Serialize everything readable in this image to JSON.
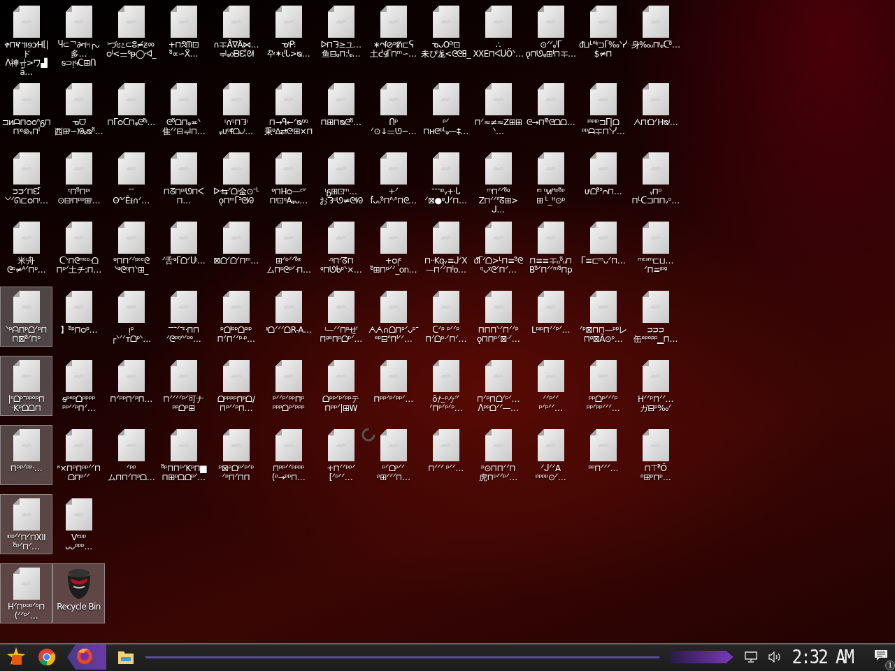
{
  "desktop": {
    "rows": [
      [
        {
          "kind": "file",
          "label": "ቀ⊓ኛ៕ɘɔ⁄H[|ド\nᐱ神ᆉ>ワ▟ǻ…",
          "selected": false
        },
        {
          "kind": "file",
          "label": "Ⴗ⊂ᄀ∂ન৸┌ᴗ多…\nᵴ⊃ᴉ५ᑕ⊞ᑎ",
          "selected": false
        },
        {
          "kind": "file",
          "label": "ᵎづ೮೭⊂ⵓ≠ᵶᇮ\nᴑᑊ<ᆖ⁶ᵽ◯ᐗ_",
          "selected": false
        },
        {
          "kind": "file",
          "label": "+⊓ᘝᗰ⊡\nᵒ̃∝∽Ẍ…",
          "selected": false
        },
        {
          "kind": "file",
          "label": "∩ᆍÅ∇Ä⋈…\nᆗᵩ᧐ᗸᘿᘛ",
          "selected": false
        },
        {
          "kind": "file",
          "label": "ᓀᵎᑭ⫶\n卆✶ɩᑊᒐ>ᴓ…",
          "selected": false
        },
        {
          "kind": "file",
          "label": "ᐅ⊓ᘊ≥ユ…\n鱼⊟ᵩ⊓:ᑊᵩ…",
          "selected": false
        },
        {
          "kind": "file",
          "label": "∗ᴖᵮ⊘ᵖᵺ⊏ᕋ\n土ᕍ፶ᒥ⊓ᵐ∽…",
          "selected": false
        },
        {
          "kind": "file",
          "label": "ᓀᴗO⁰ᵎ⊡\n未ぴ尨<ᘓᘓ𐌇_",
          "selected": false
        },
        {
          "kind": "file",
          "label": "∴\nXXE⊓ᐸᑌÖᐠ…",
          "selected": false
        },
        {
          "kind": "file",
          "label": "⊙ᐟᐟᵩᑊᒥ\nǫ⊓ᘎᵩ⊞ᑊ⊓ᆍ…",
          "selected": false
        },
        {
          "kind": "file",
          "label": "ᵭ⊔ᒻᐢᑊᵎ⊐ᒥ‰ᐠᓯ\n$≠⊓",
          "selected": false
        },
        {
          "kind": "file",
          "label": "身‰ᵤ⊓ᵎᵩᑕᵒ̃…",
          "selected": false
        }
      ],
      [
        {
          "kind": "file",
          "label": "⊐ᴎᗩ⊓ᴑᴑᐢᵷ⊓\n⊓ᵡᵎ⊚ᵧ⊓ᑊ",
          "selected": false
        },
        {
          "kind": "file",
          "label": "ᓀᗜ\n西⊞ᵎ∽ᘠᵩᴓᵒ̃…",
          "selected": false
        },
        {
          "kind": "file",
          "label": "⊓ᒥᴑᑕ⊓ᵩᘓᵒ̃ᵎ…",
          "selected": false
        },
        {
          "kind": "file",
          "label": "ᘓᵒ̃ᗝ⊓ᵩ≖ᐠ\n隹ᐟᐟ⊟ᆗ⊓…",
          "selected": false
        },
        {
          "kind": "file",
          "label": "ᵎ∩ᵑ⊓ᘊᵎ\nᵩᴜᵑᵎᵮᗝᴗᵎ…",
          "selected": false
        },
        {
          "kind": "file",
          "label": "⊓→ᑫ←ᐟᴓᵑᵑ\n秉ᵍ∆⇄ᘓᵎ⊞×⊓",
          "selected": false
        },
        {
          "kind": "file",
          "label": "⊓⊞⊓ᴓᘓᵒ̃…",
          "selected": false
        },
        {
          "kind": "file",
          "label": "ᑎᵖ\nᐟ⊙↓ᆖᘎ∽…",
          "selected": false
        },
        {
          "kind": "file",
          "label": "ᵖᐟ\n⊓ʜᘓᵇᒻᵩ—‡…",
          "selected": false
        },
        {
          "kind": "file",
          "label": "⊓ᐟ≈≠≈Z⊞⊞ᐠ…",
          "selected": false
        },
        {
          "kind": "file",
          "label": "ᘓ→⊓ᑊᵒ̃ᘓᗝᗝ…",
          "selected": false
        },
        {
          "kind": "file",
          "label": "ᵎᵒᵖᵎᵖ⊐ᒥ|ᗝ\nᵖᵖᗩᆍ⊓ᐠᓯ…",
          "selected": false
        },
        {
          "kind": "file",
          "label": "ᗅ⊓ᵎᗝᐟHᴓᵎ…",
          "selected": false
        }
      ],
      [
        {
          "kind": "file",
          "label": "ᴝᴝᐟ⊓ᘿ\nᐠᐟᐟᘏ⊏ᴑ⊓ᵎ…",
          "selected": false
        },
        {
          "kind": "file",
          "label": "ᵋ⊓ᵒ̃⊓ᵖᵎ\n⊙⊟ᵎ⊓ᵖᵖ⊞ᵎ…",
          "selected": false
        },
        {
          "kind": "file",
          "label": "ᐨᐨ\nʘᐢᐟÊᵻ∩ᐟ…",
          "selected": false
        },
        {
          "kind": "file",
          "label": "⊓ᘔ⊓ᵖᵎᘎ⊓ᐸ⊓…",
          "selected": false
        },
        {
          "kind": "file",
          "label": "ᐅᐧ⇆ᐟᗝᵎ金⊙ᐨᒻ\nǫ⊓ᵐᒥᐣᘓᘗ",
          "selected": false
        },
        {
          "kind": "file",
          "label": "ᵠ⊓Hᴑ—ᵋᐡ\n⊓ᵎ⊡ᵑAᵩᴗ…",
          "selected": false
        },
        {
          "kind": "file",
          "label": "ᵎᵷ⊞⊡ᵐ…\nおᘊᵖᘎ≠ᘓᵎᘗ",
          "selected": false
        },
        {
          "kind": "file",
          "label": "+ᐟ\nf̂ᴗᵤᵒ̃⊓ᐢᐧᐢ⊓ᘓ…",
          "selected": false
        },
        {
          "kind": "file",
          "label": "ᐨᐨᐨᵎᵖᵧ+ᐧᒐ\nᐟ⊠●ᵠᒍᐟ⊓…",
          "selected": false
        },
        {
          "kind": "file",
          "label": "ᵐ⊓ᐟᐟᵒ̃ᵍ\nZ⊓ᐟᐟᐢᘔ⊞>ᒍ…",
          "selected": false
        },
        {
          "kind": "file",
          "label": "ᵎᵋᵎ ᵑᴎᴴᵖᵒ̃ᵖ\n⊞ ᒻ_ᴴ⊙ᵖ",
          "selected": false
        },
        {
          "kind": "file",
          "label": "ᴜᵎᗝᵉ̃ᐣᴒ⊓…",
          "selected": false
        },
        {
          "kind": "file",
          "label": "ᵧ⊓ᵖ\n⊓ᒻᑕ⊐⊓⊓ᵥᵒ…",
          "selected": false
        }
      ],
      [
        {
          "kind": "file",
          "label": "米ᵎ舟\nᘓᵖ≠ᴬᐟ⊓ᵖ…",
          "selected": false
        },
        {
          "kind": "file",
          "label": "ᑕᐠ⊓ᘓᵐᵋᵒᐧᗝ\n⊓ᵖᐟ土チ:⊓…",
          "selected": false
        },
        {
          "kind": "file",
          "label": "ᵠ⊓⊓ᐟᐟᵖᵋᵉᘓ\nᐠᵠᘓᵑ⊓ᐠ⊞_",
          "selected": false
        },
        {
          "kind": "file",
          "label": "ᐟ舌ᵠᒥᗝᐟᑌᵎ…",
          "selected": false
        },
        {
          "kind": "file",
          "label": "⊠ᗝᐟᗝᐟ⊓ᵐ…",
          "selected": false
        },
        {
          "kind": "file",
          "label": "⊞ᐟᵖᐟᐟᵒ̃ᵎᵋ\nム⊓ᵖᘓᵖᐟᐧ⊓…",
          "selected": false
        },
        {
          "kind": "file",
          "label": "ᐧᵑ⊓ᐟᘔ⊓\nᵍ⊓ᘎᑲᵖᐠ×…",
          "selected": false
        },
        {
          "kind": "file",
          "label": "+ᴑᴉᵋ\nᵉ̃⊞⊓ᵖᐟᐟ_on…",
          "selected": false
        },
        {
          "kind": "file",
          "label": "⊓ᐧᐧKqᵥ≡ᒍᐟX\n—⊓ᐟᐟ⊓ᑊo…",
          "selected": false
        },
        {
          "kind": "file",
          "label": "ᵭᒥᐟᗝ>ᒻ⊓≡ᵒ̃ᘓ\nᵑᴗᵡᘓᐟ⊓ᐟ…",
          "selected": false
        },
        {
          "kind": "file",
          "label": "⊓≡≡ᆍᵤᵒ̃ᵤ⊓\nBᵒ̃ᐟ⊓ᐟᐟᵐᵒ̃⊓p",
          "selected": false
        },
        {
          "kind": "file",
          "label": "ᒥ≡⊏ᵐᴗᐟ⊓…",
          "selected": false
        },
        {
          "kind": "file",
          "label": "ᵐᵋᵌᵐ⊏⊔…\nᐟ⊓≡ᵎᵖᵍ",
          "selected": false
        }
      ],
      [
        {
          "kind": "file",
          "label": "ᐠᵖᗩ⊓ᵖᗝᐟᵖ⊓\n⊓⊠ᵒ̃ᐟ⊓ᵖ",
          "selected": true
        },
        {
          "kind": "file",
          "label": "】ᵉ̃ᵖ⊓ᴑᵖ…",
          "selected": false
        },
        {
          "kind": "file",
          "label": "ᴉᵖ\n┌ᐠᐟᐟᴛᗝᵖᐠ…",
          "selected": false
        },
        {
          "kind": "file",
          "label": "ᐨᐨᐨᐟᐨᵋᐧ⊓⊓\nᐟᘓᵖᵑᐢᐟᵒᵒ…",
          "selected": false
        },
        {
          "kind": "file",
          "label": "ᵖᗝᑊᵖᵖᗝᵖᵎᵖ\n⊓ᐟ⊓ᐟᐟᵖᐧᵖ…",
          "selected": false
        },
        {
          "kind": "file",
          "label": "ᵡᗝᐟᐟᐟᗝR-A…",
          "selected": false
        },
        {
          "kind": "file",
          "label": "ᵎ—ᐟᐟ⊓ᵖぜ\n⊓ᵍᵉ⊓ᵖᗝᵖᐟ…",
          "selected": false
        },
        {
          "kind": "file",
          "label": "ᗅᗅ∩ᗝ⊓ᵖᐟᴗᵖᐨ\nᵉᵖ⊟ᐢ⊓ᑊᐟᐟ…",
          "selected": false
        },
        {
          "kind": "file",
          "label": "ᑕᐟᵖ ᵖᐟᐟᵖ\n⊓ᐟᗝᵖᐧᐟ⊓ᐟ…",
          "selected": false
        },
        {
          "kind": "file",
          "label": "⊓⊓⊓ᐠᐟ⊓ᐟᐟᵖ\nǫ⊓⊓ᵖᐟ⊠ᐧᐟ…",
          "selected": false
        },
        {
          "kind": "file",
          "label": "Lᵖᵎᵖ⊓ᐟᐟᵖᐟ…",
          "selected": false
        },
        {
          "kind": "file",
          "label": "ᐟᵖ⊠⊓⊓—ᵖᵖレ\n⊓ᵍ⊠Ã⊙ᵖ…",
          "selected": false
        },
        {
          "kind": "file",
          "label": "ᴝᴝᴝ\n缶ᵉᵖᵒᵖᵖ▁⊓…",
          "selected": false
        }
      ],
      [
        {
          "kind": "file",
          "label": "|ᵋᗝᵖᐨᵖᵖᵒᵖ⊓\nᐧKᵖᗝᗝ⊓",
          "selected": true
        },
        {
          "kind": "file",
          "label": "ᵴᵖᵉᵖᗝᵖᵖᵖᵖ\nᵖᵖᐟᐟᵖ⊓ᐟ…",
          "selected": false
        },
        {
          "kind": "file",
          "label": "⊓ᐟᵖᵖ⊓ᐟᵖ⊓…",
          "selected": false
        },
        {
          "kind": "file",
          "label": "⊓ᐟᐟᐟᐟᵖᐟ可ナ\nᵖᵖᗝᵖ⊞",
          "selected": false
        },
        {
          "kind": "file",
          "label": "ᗝᵖᵖᵖᵖ⊓ᵖᗝ/\n⊓ᵖᐟᐟᵖ⊓…",
          "selected": false
        },
        {
          "kind": "file",
          "label": "ᵖᐟᐟᵖᐟᵖᵖ⊓ᵖ\nᵖᵖᵖᗝᵖᐟᵖᵖᵖ",
          "selected": false
        },
        {
          "kind": "file",
          "label": "ᗝᵖᵖᐟᵖᐟᵖᵖテ\n⊓ᵖᵖᐟ|⊞W",
          "selected": false
        },
        {
          "kind": "file",
          "label": "⊓ᵖᵖᐟᵖᐟᵖᵖᐟ…",
          "selected": false
        },
        {
          "kind": "file",
          "label": "ᴏ̃たᵖゲᐟ\nᐟ⊓ᵖᐟᵖᐟᵖ…",
          "selected": false
        },
        {
          "kind": "file",
          "label": "⊓ᐟᵖ⊓ᗝᐟᵖᐟ…\nᐱᵖᵖᗝᐟᐟ—…",
          "selected": false
        },
        {
          "kind": "file",
          "label": "ᐟᐟᵖᐟᐟ\nᵖᐟᵖᐟᐟ…",
          "selected": false
        },
        {
          "kind": "file",
          "label": "ᵖᵖᗝᵖᐟᐟᐟᵖ\nᵖᵖᐟᵖᵖᐟᐟᐟ…",
          "selected": false
        },
        {
          "kind": "file",
          "label": "Hᐟᐟᵖ⊓ᐟᐟ…\nガ⊟ᵖ‰ᐟ",
          "selected": false
        }
      ],
      [
        {
          "kind": "file",
          "label": "⊓ᵖᵖᐟᵖᵖᐧ…",
          "selected": true
        },
        {
          "kind": "file",
          "label": "ᵃ×⊓ᵖ⊓ᵖᵖᐟᐟ⊓\nᗝ⊓ᵖᐟᐟ",
          "selected": false
        },
        {
          "kind": "file",
          "label": "ᐟᵖᵖ\nム⊓⊓ᐟ⊓ᵖᗝ…",
          "selected": false
        },
        {
          "kind": "file",
          "label": "ᵒ̃ᵖ⊓⊓ᵖᐟKᵖ⊓▆\n⊓⊞ᵖᗝᗝᵖᐟ…",
          "selected": false
        },
        {
          "kind": "file",
          "label": "ᵖ⊠ᵖᗝᵖᐟᵖᐟᵖ\nᐟᵖ⊓ᐟ⊓⊓",
          "selected": false
        },
        {
          "kind": "file",
          "label": "⊓ᵖᵖᐟᐟᵖᵖᵖᵖ\n(ᵖ→ᵖᵖ⊓…",
          "selected": false
        },
        {
          "kind": "file",
          "label": "+⊓ᐟᐟᵖᵖᐟ\n[ᐟᵖᐟᐟ…",
          "selected": false
        },
        {
          "kind": "file",
          "label": "ᵖᐟᗝᵖᐟᐟ\nᵖ⊞ᐟᐟᐟ⊓…",
          "selected": false
        },
        {
          "kind": "file",
          "label": "⊓ᐟᐟᐟ ᵖᐟᐟ…",
          "selected": false
        },
        {
          "kind": "file",
          "label": "ᵖ⊙⊓⊓ᐟᐟ⊓\n虎⊓ᵖᐟᐟᵖᐟ…",
          "selected": false
        },
        {
          "kind": "file",
          "label": "ᐟᒍᐟᐟA\nᵖᵖᵖᵖ⊙ᐟ…",
          "selected": false
        },
        {
          "kind": "file",
          "label": "ᵖᵖ⊓ᐟᐟᐟ…",
          "selected": false
        },
        {
          "kind": "file",
          "label": "⊓⊤ᵉ̃Ő\nᵒ⊞ᵖ⊓ᵖ…",
          "selected": false
        }
      ],
      [
        {
          "kind": "file",
          "label": "ᵎᵖᵖᐟᐟ⊓ᐟ⊓XII\nᵉ̃ᵖᐟ⊓ᐟ…",
          "selected": true
        },
        {
          "kind": "file",
          "label": "Vᵉᵖᵖ\nᴗᴗᵖᵖᵖ…",
          "selected": false
        }
      ],
      [
        {
          "kind": "file",
          "label": "Hᐟ⊓ᵖᵖᵖᐟᵖ⊓\n(ᐟᐟᵖᐟ…",
          "selected": true
        },
        {
          "kind": "recycle-bin",
          "label": "Recycle Bin",
          "selected": true
        }
      ]
    ]
  },
  "taskbar": {
    "clock": "2:32 AM",
    "notification_count": "1"
  }
}
